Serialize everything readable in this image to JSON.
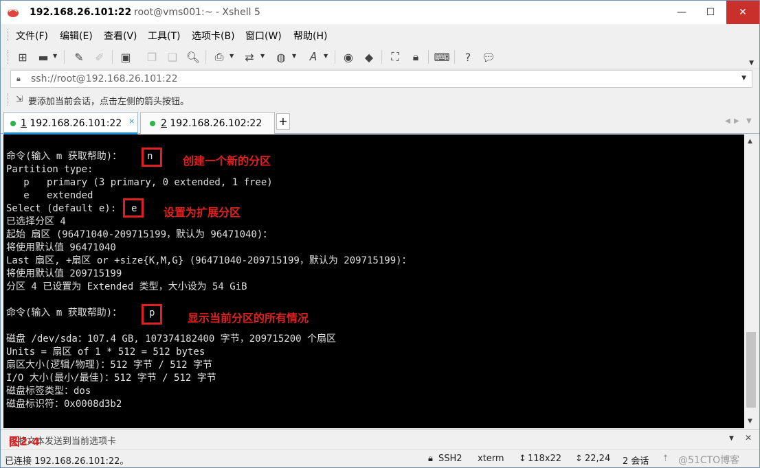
{
  "window": {
    "title_host": "192.168.26.101:22",
    "title_rest": "root@vms001:~ - Xshell 5",
    "minimize": "—",
    "maximize": "☐",
    "close": "✕"
  },
  "menu": [
    "文件(F)",
    "编辑(E)",
    "查看(V)",
    "工具(T)",
    "选项卡(B)",
    "窗口(W)",
    "帮助(H)"
  ],
  "address": {
    "url": "ssh://root@192.168.26.101:22"
  },
  "hint": {
    "text": "要添加当前会话，点击左侧的箭头按钮。"
  },
  "tabs": [
    {
      "num": "1",
      "label": "192.168.26.101:22",
      "close": "×",
      "active": true
    },
    {
      "num": "2",
      "label": "192.168.26.102:22",
      "active": false
    }
  ],
  "tab_add": "+",
  "terminal": {
    "lines": [
      "命令(输入 m 获取帮助)：",
      "Partition type:",
      "   p   primary (3 primary, 0 extended, 1 free)",
      "   e   extended",
      "Select (default e): ",
      "已选择分区 4",
      "起始 扇区 (96471040-209715199，默认为 96471040)：",
      "将使用默认值 96471040",
      "Last 扇区, +扇区 or +size{K,M,G} (96471040-209715199，默认为 209715199)：",
      "将使用默认值 209715199",
      "分区 4 已设置为 Extended 类型，大小设为 54 GiB",
      "",
      "命令(输入 m 获取帮助)：",
      "",
      "磁盘 /dev/sda：107.4 GB, 107374182400 字节，209715200 个扇区",
      "Units = 扇区 of 1 * 512 = 512 bytes",
      "扇区大小(逻辑/物理)：512 字节 / 512 字节",
      "I/O 大小(最小/最佳)：512 字节 / 512 字节",
      "磁盘标签类型：dos",
      "磁盘标识符：0x0008d3b2"
    ],
    "inputs": [
      "n",
      "e",
      "p"
    ],
    "notes": [
      "创建一个新的分区",
      "设置为扩展分区",
      "显示当前分区的所有情况"
    ]
  },
  "compose": {
    "text": "仅将文本发送到当前选项卡",
    "figure_label": "图2-4"
  },
  "status": {
    "connected": "已连接 192.168.26.101:22。",
    "protocol": "SSH2",
    "term": "xterm",
    "size": "118x22",
    "cursor": "22,24",
    "sessions": "2 会话",
    "watermark": "@51CTO博客"
  },
  "colors": {
    "annotation": "#e02020",
    "tab_accent": "#1e8fd6",
    "session_dot": "#2db34a",
    "terminal_bg": "#000000"
  }
}
